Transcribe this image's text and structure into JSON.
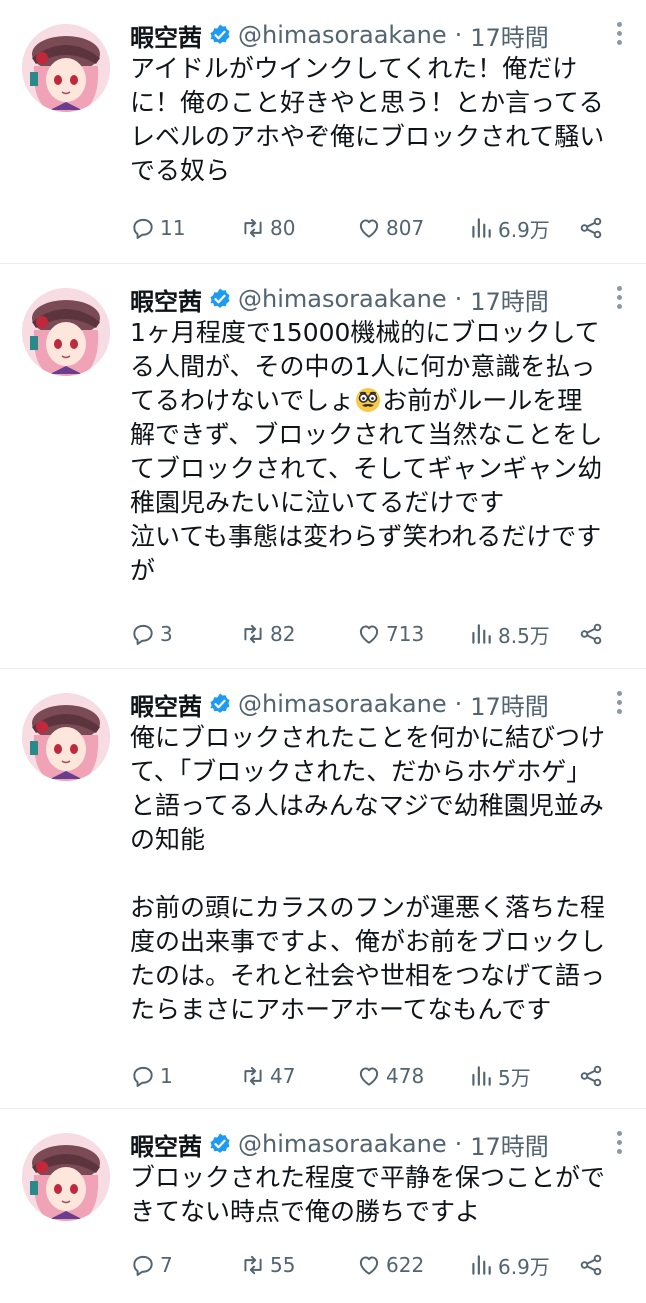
{
  "tweets": [
    {
      "name": "暇空茜",
      "handle": "@himasoraakane",
      "separator": "·",
      "time": "17時間",
      "lines": [
        "アイドルがウインクしてくれた！俺だけ",
        "に！俺のこと好きやと思う！とか言ってる",
        "レベルのアホやぞ俺にブロックされて騒い",
        "でる奴ら"
      ],
      "replies": "11",
      "retweets": "80",
      "likes": "807",
      "views": "6.9万"
    },
    {
      "name": "暇空茜",
      "handle": "@himasoraakane",
      "separator": "·",
      "time": "17時間",
      "lines": [
        "1ヶ月程度で15000機械的にブロックして",
        "る人間が、その中の1人に何か意識を払っ",
        "てるわけないでしょ",
        "解できず、ブロックされて当然なことをし",
        "てブロックされて、そしてギャンギャン幼",
        "稚園児みたいに泣いてるだけです",
        "泣いても事態は変わらず笑われるだけです",
        "が"
      ],
      "emoji_after": "お前がルールを理",
      "replies": "3",
      "retweets": "82",
      "likes": "713",
      "views": "8.5万"
    },
    {
      "name": "暇空茜",
      "handle": "@himasoraakane",
      "separator": "·",
      "time": "17時間",
      "lines": [
        "俺にブロックされたことを何かに結びつけ",
        "て、「ブロックされた、だからホゲホゲ」",
        "と語ってる人はみんなマジで幼稚園児並み",
        "の知能",
        "",
        "お前の頭にカラスのフンが運悪く落ちた程",
        "度の出来事ですよ、俺がお前をブロックし",
        "たのは。それと社会や世相をつなげて語っ",
        "たらまさにアホーアホーてなもんです"
      ],
      "replies": "1",
      "retweets": "47",
      "likes": "478",
      "views": "5万"
    },
    {
      "name": "暇空茜",
      "handle": "@himasoraakane",
      "separator": "·",
      "time": "17時間",
      "lines": [
        "ブロックされた程度で平静を保つことがで",
        "きてない時点で俺の勝ちですよ"
      ],
      "replies": "7",
      "retweets": "55",
      "likes": "622",
      "views": "6.9万"
    }
  ],
  "colors": {
    "text": "#0f1419",
    "secondary": "#536471",
    "verified": "#1d9bf0",
    "divider": "#e6ecf0"
  },
  "icons": {
    "reply": "speech-bubble-icon",
    "retweet": "retweet-icon",
    "like": "heart-icon",
    "views": "bar-chart-icon",
    "share": "share-icon",
    "more": "vertical-ellipsis-icon",
    "verified": "verified-badge-icon",
    "emoji": "disguised-face-emoji"
  }
}
